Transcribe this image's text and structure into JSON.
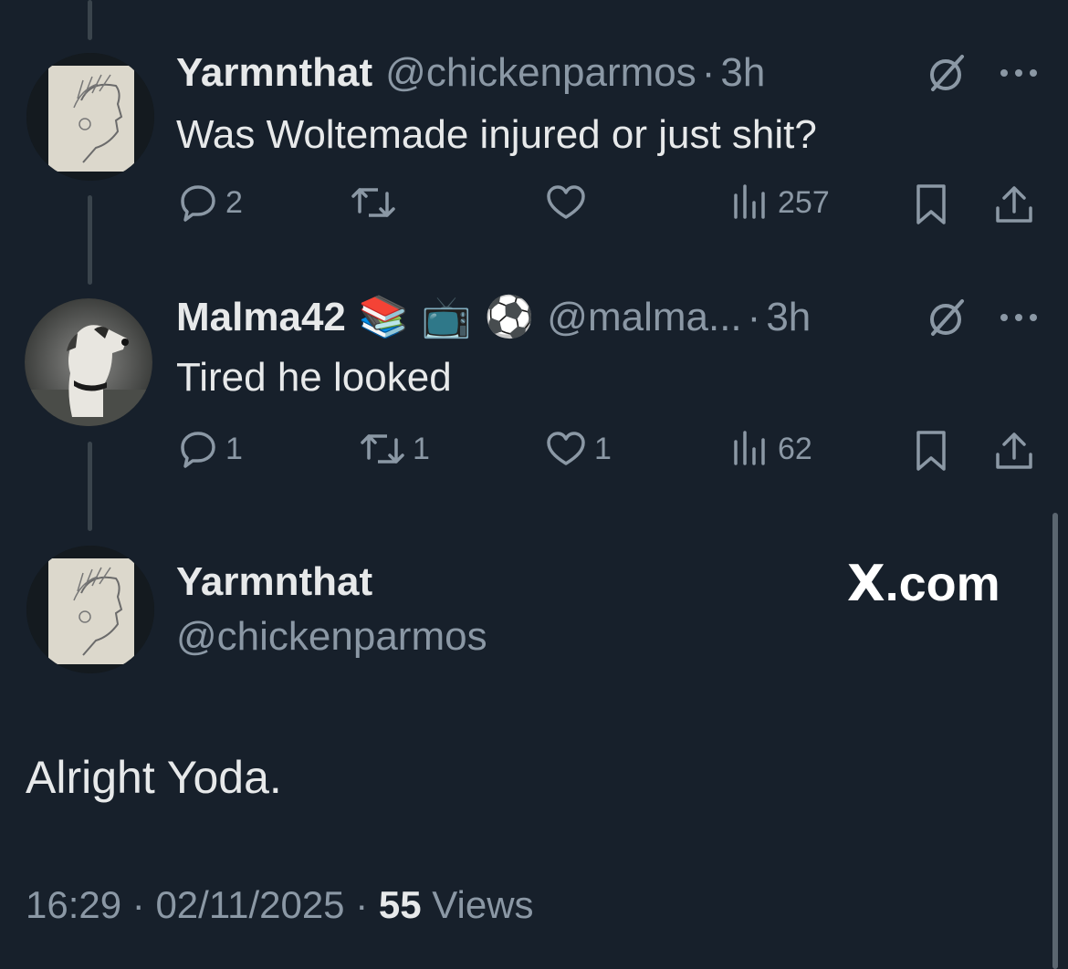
{
  "tweets": [
    {
      "display_name": "Yarmnthat",
      "handle": "@chickenparmos",
      "separator": "·",
      "time": "3h",
      "text": "Was Woltemade injured or just shit?",
      "replies": "2",
      "reposts": "",
      "likes": "",
      "views": "257"
    },
    {
      "display_name": "Malma42",
      "emojis": [
        "📚",
        "📺",
        "⚽"
      ],
      "handle": "@malma...",
      "separator": "·",
      "time": "3h",
      "text": "Tired he looked",
      "replies": "1",
      "reposts": "1",
      "likes": "1",
      "views": "62"
    }
  ],
  "main_tweet": {
    "display_name": "Yarmnthat",
    "handle": "@chickenparmos",
    "brand": "X",
    "brand_suffix": ".com",
    "text": "Alright Yoda.",
    "time": "16:29",
    "date": "02/11/2025",
    "separator": "·",
    "views_count": "55",
    "views_label": "Views"
  },
  "colors": {
    "background": "#17202b",
    "text": "#e7e9ea",
    "secondary": "#8b98a5"
  }
}
